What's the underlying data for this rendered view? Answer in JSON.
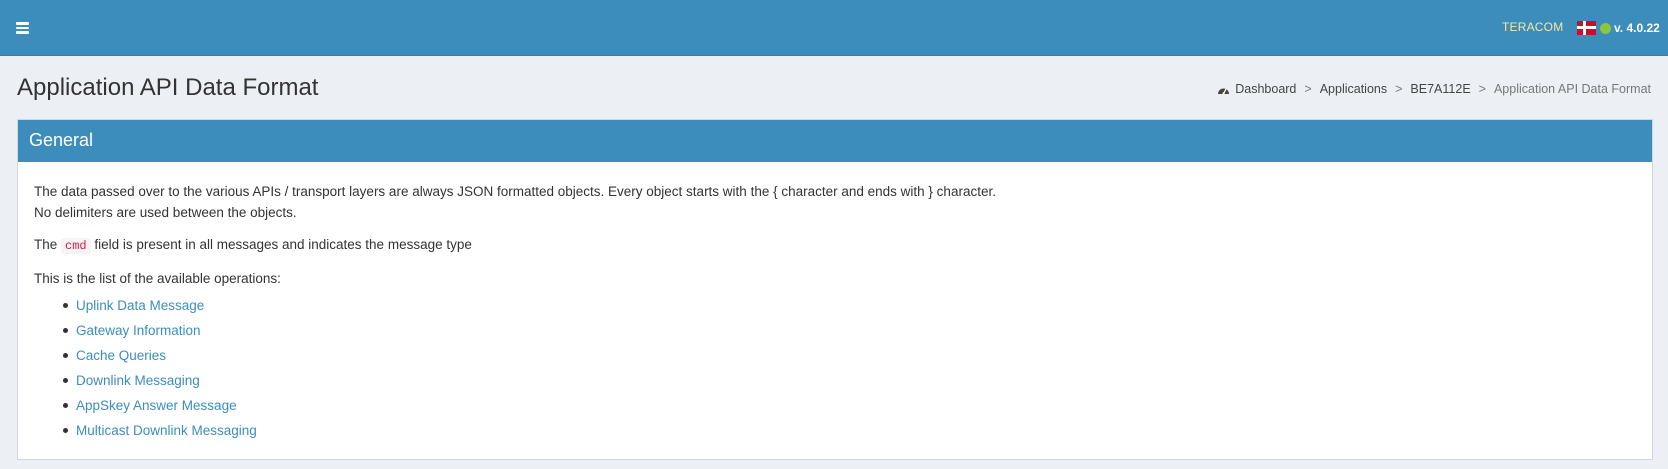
{
  "header": {
    "brand": "TERACOM",
    "version": "v. 4.0.22",
    "flag_icon": "denmark-flag-icon",
    "status_color": "#8cc63f",
    "accent_color": "#3c8dbc"
  },
  "page": {
    "title": "Application API Data Format"
  },
  "breadcrumb": {
    "items": [
      {
        "label": "Dashboard",
        "icon": "dashboard-icon"
      },
      {
        "label": "Applications"
      },
      {
        "label": "BE7A112E"
      }
    ],
    "separator": ">",
    "active": "Application API Data Format"
  },
  "box": {
    "title": "General",
    "paragraph1_line1": "The data passed over to the various APIs / transport layers are always JSON formatted objects. Every object starts with the { character and ends with } character.",
    "paragraph1_line2": "No delimiters are used between the objects.",
    "paragraph2_before": "The",
    "paragraph2_code": "cmd",
    "paragraph2_after": "field is present in all messages and indicates the message type",
    "paragraph3": "This is the list of the available operations:",
    "operations": [
      "Uplink Data Message",
      "Gateway Information",
      "Cache Queries",
      "Downlink Messaging",
      "AppSkey Answer Message",
      "Multicast Downlink Messaging"
    ]
  }
}
